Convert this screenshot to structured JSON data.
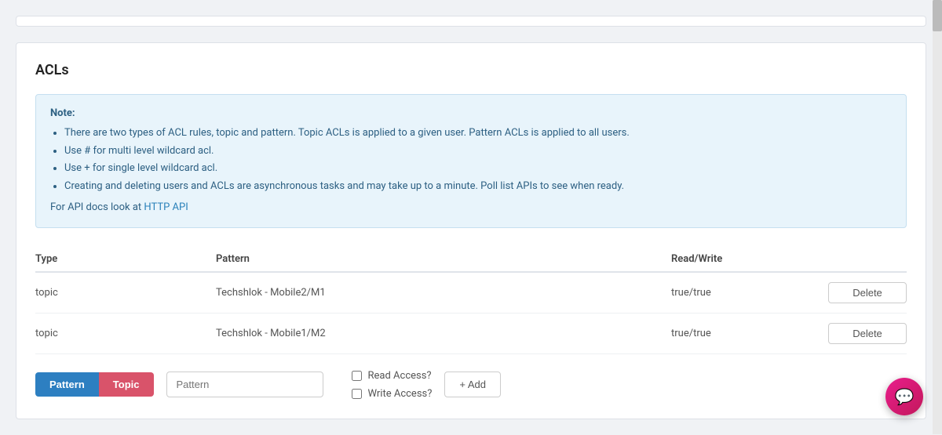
{
  "page": {
    "title": "ACLs"
  },
  "note": {
    "label": "Note:",
    "bullets": [
      "There are two types of ACL rules, topic and pattern. Topic ACLs is applied to a given user. Pattern ACLs is applied to all users.",
      "Use # for multi level wildcard acl.",
      "Use + for single level wildcard acl.",
      "Creating and deleting users and ACLs are asynchronous tasks and may take up to a minute. Poll list APIs to see when ready."
    ],
    "api_text": "For API docs look at HTTP API",
    "api_link": "HTTP API"
  },
  "table": {
    "headers": [
      "Type",
      "Pattern",
      "Read/Write",
      ""
    ],
    "rows": [
      {
        "type": "topic",
        "pattern": "Techshlok - Mobile2/M1",
        "readwrite": "true/true",
        "delete_label": "Delete"
      },
      {
        "type": "topic",
        "pattern": "Techshlok - Mobile1/M2",
        "readwrite": "true/true",
        "delete_label": "Delete"
      }
    ]
  },
  "form": {
    "pattern_btn_label": "Pattern",
    "topic_btn_label": "Topic",
    "pattern_placeholder": "Pattern",
    "read_access_label": "Read Access?",
    "write_access_label": "Write Access?",
    "add_label": "+ Add"
  },
  "fab": {
    "icon": "💬"
  }
}
